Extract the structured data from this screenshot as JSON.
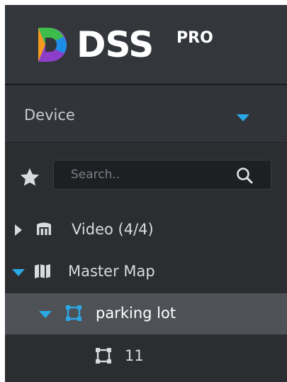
{
  "brand": {
    "name": "DSS",
    "edition": "PRO",
    "colors": {
      "green": "#3dbb4b",
      "orange": "#f39a1f",
      "purple": "#8d3ec9",
      "blue": "#1d8ee6"
    }
  },
  "device_selector": {
    "label": "Device",
    "accent": "#2aa8e6"
  },
  "search": {
    "placeholder": "Search.."
  },
  "tree": [
    {
      "label": "Video (4/4)",
      "icon": "video-device-icon",
      "expanded": false
    },
    {
      "label": "Master Map",
      "icon": "map-icon",
      "expanded": true
    },
    {
      "label": "parking lot",
      "icon": "map-frame-icon",
      "expanded": true,
      "selected": true
    },
    {
      "label": "11",
      "icon": "map-frame-icon",
      "expanded": false
    }
  ],
  "colors": {
    "panel_bg": "#2b2d30",
    "header_bg": "#33363b",
    "selected_row_bg": "#4e5257",
    "text": "#d8dadd",
    "accent": "#2aa8e6"
  }
}
